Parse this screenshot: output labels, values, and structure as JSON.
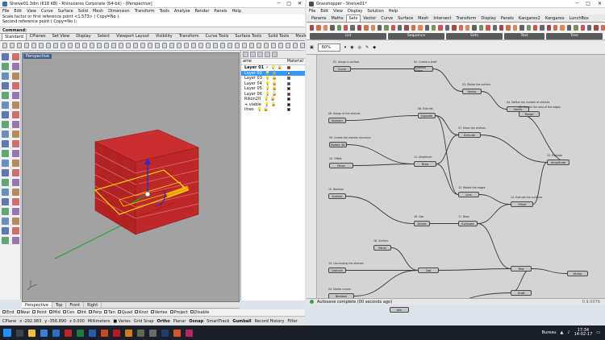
{
  "rhino": {
    "title": "Shelve01.3dm (618 KB) - Rhinoceros Corporate (64-bit) - [Perspective]",
    "menu": [
      "File",
      "Edit",
      "View",
      "Curve",
      "Surface",
      "Solid",
      "Mesh",
      "Dimension",
      "Transform",
      "Tools",
      "Analyze",
      "Render",
      "Panels",
      "Help"
    ],
    "history": [
      "Scale factor or first reference point <1.573> ( Copy=No ):",
      "Second reference point ( Copy=No ):"
    ],
    "command_prompt": "Command:",
    "tabs": [
      "Standard",
      "CPlanes",
      "Set View",
      "Display",
      "Select",
      "Viewport Layout",
      "Visibility",
      "Transform",
      "Curve Tools",
      "Surface Tools",
      "Solid Tools",
      "Mesh Tools",
      "Render Tools",
      "Draf"
    ],
    "viewport_label": "Perspective",
    "view_tabs": [
      "Perspective",
      "Top",
      "Front",
      "Right"
    ],
    "layers": {
      "col_name": "ame",
      "col_mat": "Material",
      "rows": [
        {
          "name": "Layer 01",
          "check": "✓",
          "color": "#cc0000",
          "selected": false,
          "bold": true
        },
        {
          "name": "Layer 02",
          "check": "",
          "color": "#ffffff",
          "selected": true,
          "bold": false
        },
        {
          "name": "Layer 03",
          "check": "",
          "color": "#0a7d2a",
          "selected": false,
          "bold": false
        },
        {
          "name": "Layer 04",
          "check": "",
          "color": "#1c2fd6",
          "selected": false,
          "bold": false
        },
        {
          "name": "Layer 05",
          "check": "",
          "color": "#111111",
          "selected": false,
          "bold": false
        },
        {
          "name": "Layer 06",
          "check": "",
          "color": "#cc0000",
          "selected": false,
          "bold": false
        },
        {
          "name": "Rikon20",
          "check": "",
          "color": "#111111",
          "selected": false,
          "bold": false
        },
        {
          "name": "+ viable",
          "check": "",
          "color": "#111111",
          "selected": false,
          "bold": false
        },
        {
          "name": "lines",
          "check": "",
          "color": "#111111",
          "selected": false,
          "bold": false
        }
      ]
    },
    "osnaps": [
      "End",
      "Near",
      "Point",
      "Mid",
      "Cen",
      "Int",
      "Perp",
      "Tan",
      "Quad",
      "Knot",
      "Vertex",
      "Project",
      "Disable"
    ],
    "status": [
      "CPlane",
      "x -292.983",
      "y -356.890",
      "z 0.000",
      "Millimeters",
      "■ Varies",
      "Grid Snap",
      "Ortho",
      "Planar",
      "Osnap",
      "SmartTrack",
      "Gumball",
      "Record History",
      "Filter"
    ]
  },
  "grasshopper": {
    "title": "Grasshopper - Shelve01*",
    "menu": [
      "File",
      "Edit",
      "View",
      "Display",
      "Solution",
      "Help"
    ],
    "tabs": [
      "Params",
      "Maths",
      "Sets",
      "Vector",
      "Curve",
      "Surface",
      "Mesh",
      "Intersect",
      "Transform",
      "Display",
      "Panels",
      "Kangaroo2",
      "Kangaroo",
      "LunchBox"
    ],
    "active_tab": "Sets",
    "ribbon_groups": [
      "List",
      "Sequence",
      "Sets",
      "Text",
      "Tree"
    ],
    "zoom": "60%",
    "status_text": "Autosave complete (00 seconds ago)",
    "version": "0.9.0076",
    "nodes": [
      "Curve",
      "Number Slider",
      "Series",
      "Series",
      "Range",
      "Explode",
      "Extrude",
      "Number",
      "Rotate 3D",
      "Move",
      "Brep",
      "Amplitude",
      "Line",
      "Offset",
      "Surface",
      "Divide",
      "Evaluate",
      "Panel",
      "Domain",
      "Boolean",
      "Cap",
      "Text",
      "Vector",
      "Graft",
      "Join"
    ],
    "groups": [
      "01. Assign a surface",
      "02. Create a shelf",
      "03. Divide the surface",
      "04. Define the number of shelves",
      "05. Create the area of the edges",
      "06. Extrude",
      "07. Move the shelves",
      "08. Range of the shelves",
      "09. Create the shelves structure",
      "10. Offset",
      "11. Amplitude",
      "12. Explode",
      "13. Rotate the edges",
      "14. Extrude the surfaces",
      "15. Boolean",
      "16. Cap",
      "17. Brep",
      "18. Surface",
      "19. Connecting the shelves",
      "20. Divide curves"
    ]
  },
  "taskbar": {
    "lang": "Bureau",
    "time": "17:34",
    "date": "14-02-17"
  }
}
